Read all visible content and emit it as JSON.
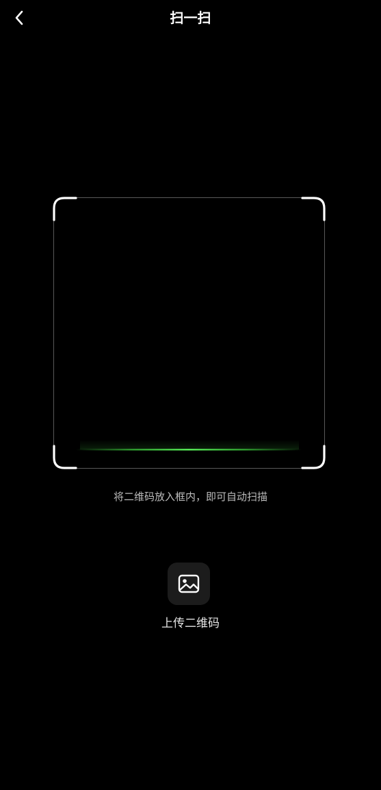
{
  "header": {
    "title": "扫一扫",
    "back_icon": "chevron-left-icon"
  },
  "scanner": {
    "hint": "将二维码放入框内，即可自动扫描",
    "scan_line_color": "#3ed23e",
    "frame_color": "#ffffff"
  },
  "upload": {
    "icon": "image-icon",
    "label": "上传二维码"
  },
  "colors": {
    "background": "#000000",
    "button_background": "#1c1c1c"
  }
}
